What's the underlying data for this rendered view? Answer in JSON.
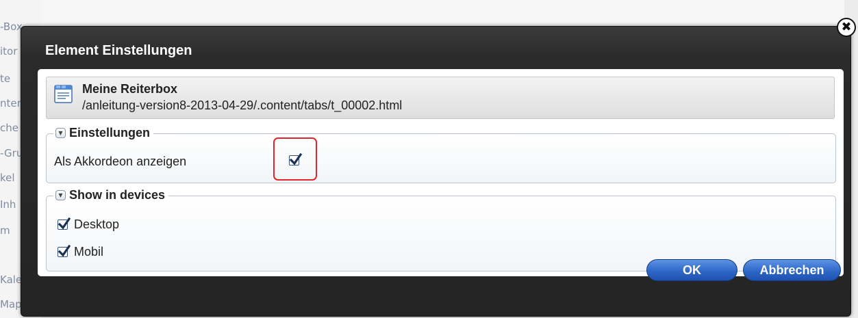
{
  "background": {
    "sidebar_items": [
      "-Box",
      "itor",
      "te",
      "nten",
      "che",
      "-Gru",
      "kel",
      "Inh",
      "m",
      "Kale",
      "Map"
    ]
  },
  "dialog": {
    "title": "Element Einstellungen",
    "close_icon": "close-x-icon",
    "element": {
      "icon": "tab-document-icon",
      "name": "Meine Reiterbox",
      "path": "/anleitung-version8-2013-04-29/.content/tabs/t_00002.html"
    },
    "settings_group": {
      "legend": "Einstellungen",
      "fields": [
        {
          "label": "Als Akkordeon anzeigen",
          "checked": true
        }
      ]
    },
    "devices_group": {
      "legend": "Show in devices",
      "options": [
        {
          "label": "Desktop",
          "checked": true
        },
        {
          "label": "Mobil",
          "checked": true
        }
      ]
    },
    "buttons": {
      "ok": "OK",
      "cancel": "Abbrechen"
    },
    "highlight_color": "#e2242b"
  }
}
